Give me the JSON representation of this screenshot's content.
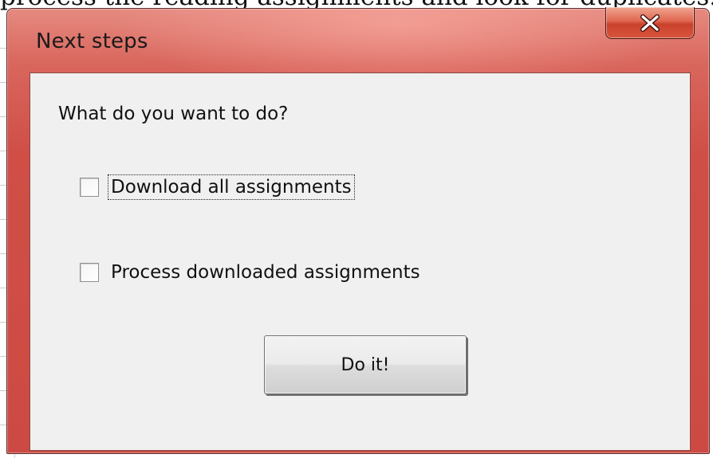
{
  "background": {
    "text": "process the reading assignments and look for duplicates."
  },
  "window": {
    "title": "Next steps",
    "close_icon": "close-x-icon"
  },
  "dialog": {
    "prompt": "What do you want to do?",
    "options": [
      {
        "label": "Download all assignments",
        "checked": false,
        "focused": true
      },
      {
        "label": "Process downloaded assignments",
        "checked": false,
        "focused": false
      }
    ],
    "action_label": "Do it!"
  },
  "colors": {
    "frame_accent": "#cf4f47",
    "close_button": "#d8553d",
    "client_bg": "#f0f0f0"
  }
}
